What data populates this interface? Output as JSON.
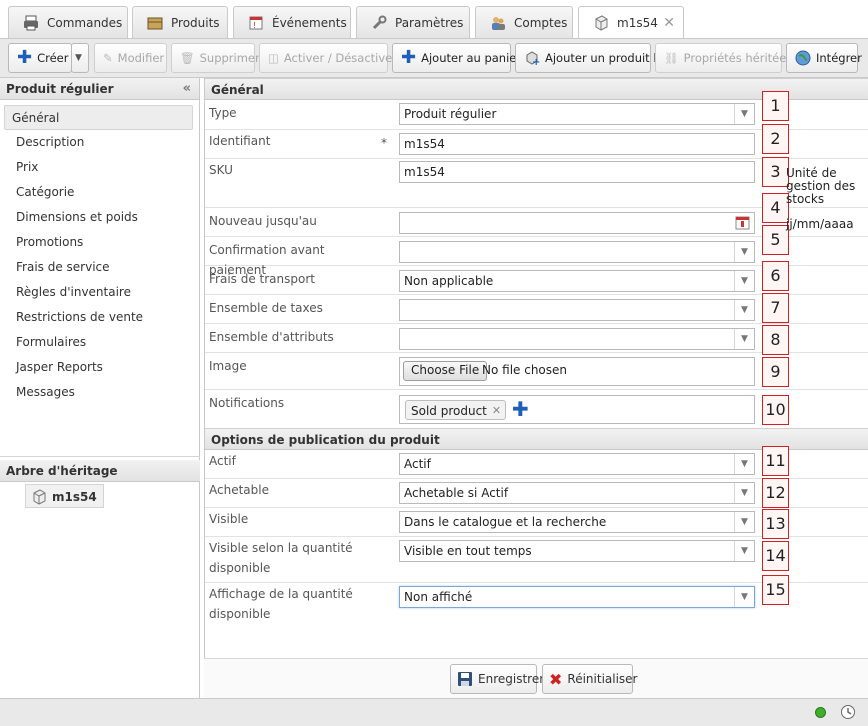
{
  "tabs": [
    {
      "label": "Commandes",
      "icon": "printer-icon"
    },
    {
      "label": "Produits",
      "icon": "box-icon"
    },
    {
      "label": "Événements",
      "icon": "calendar-icon"
    },
    {
      "label": "Paramètres",
      "icon": "wrench-icon"
    },
    {
      "label": "Comptes",
      "icon": "users-icon"
    },
    {
      "label": "m1s54",
      "icon": "product-icon",
      "closable": true
    }
  ],
  "toolbar": {
    "create": "Créer",
    "modify": "Modifier",
    "delete": "Supprimer",
    "activate": "Activer / Désactiver",
    "add_to_cart": "Ajouter au panier",
    "add_linked": "Ajouter un produit lié",
    "inherited": "Propriétés héritées",
    "integrate": "Intégrer"
  },
  "left_panel": {
    "title": "Produit régulier",
    "nav": [
      "Général",
      "Description",
      "Prix",
      "Catégorie",
      "Dimensions et poids",
      "Promotions",
      "Frais de service",
      "Règles d'inventaire",
      "Restrictions de vente",
      "Formulaires",
      "Jasper Reports",
      "Messages"
    ],
    "tree_title": "Arbre d'héritage",
    "tree_node": "m1s54"
  },
  "form": {
    "section_general": "Général",
    "section_publish": "Options de publication du produit",
    "fields": {
      "type": {
        "label": "Type",
        "value": "Produit régulier",
        "num": "1"
      },
      "ident": {
        "label": "Identifiant",
        "value": "m1s54",
        "num": "2",
        "required_mark": "*"
      },
      "sku": {
        "label": "SKU",
        "value": "m1s54",
        "num": "3",
        "side": "Unité de gestion des stocks"
      },
      "new_until": {
        "label": "Nouveau jusqu'au",
        "value": "",
        "num": "4",
        "side": "jj/mm/aaaa"
      },
      "confirm": {
        "label": "Confirmation avant paiement",
        "value": "",
        "num": "5"
      },
      "shipping": {
        "label": "Frais de transport",
        "value": "Non applicable",
        "num": "6"
      },
      "taxes": {
        "label": "Ensemble de taxes",
        "value": "",
        "num": "7"
      },
      "attributes": {
        "label": "Ensemble d'attributs",
        "value": "",
        "num": "8"
      },
      "image": {
        "label": "Image",
        "button": "Choose File",
        "status": "No file chosen",
        "num": "9"
      },
      "notifications": {
        "label": "Notifications",
        "tag": "Sold product",
        "num": "10"
      },
      "active": {
        "label": "Actif",
        "value": "Actif",
        "num": "11"
      },
      "buyable": {
        "label": "Achetable",
        "value": "Achetable si Actif",
        "num": "12"
      },
      "visible": {
        "label": "Visible",
        "value": "Dans le catalogue et la recherche",
        "num": "13"
      },
      "visible_qty": {
        "label": "Visible selon la quantité disponible",
        "value": "Visible en tout temps",
        "num": "14"
      },
      "qty_display": {
        "label": "Affichage de la quantité disponible",
        "value": "Non affiché",
        "num": "15"
      }
    }
  },
  "footer": {
    "save": "Enregistrer",
    "reset": "Réinitialiser"
  },
  "colors": {
    "accent_red": "#d02020",
    "status_green": "#3fae2a",
    "plus_blue": "#1f5fb8"
  }
}
